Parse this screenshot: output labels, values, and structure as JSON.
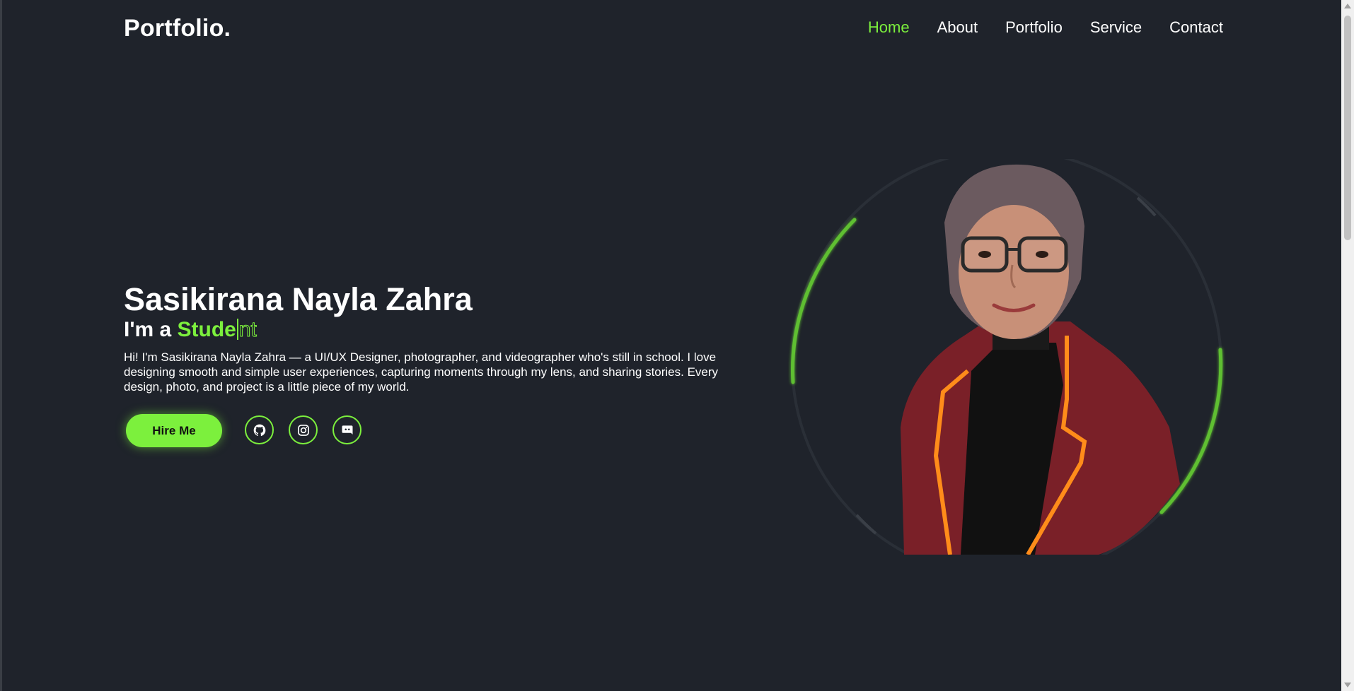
{
  "header": {
    "logo": "Portfolio.",
    "nav": [
      "Home",
      "About",
      "Portfolio",
      "Service",
      "Contact"
    ],
    "active_nav": "Home"
  },
  "hero": {
    "name": "Sasikirana Nayla Zahra",
    "role_prefix": "I'm a",
    "role_typed": "Stude",
    "role_rest": "nt",
    "description": "Hi! I'm Sasikirana Nayla Zahra — a UI/UX Designer, photographer, and videographer who's still in school. I love designing smooth and simple user experiences, capturing moments through my lens, and sharing stories. Every design, photo, and project is a little piece of my world.",
    "hire_label": "Hire Me",
    "socials": [
      "github-icon",
      "instagram-icon",
      "discord-icon"
    ]
  },
  "colors": {
    "background": "#1f232b",
    "accent": "#7cf03d",
    "text": "#ffffff"
  }
}
